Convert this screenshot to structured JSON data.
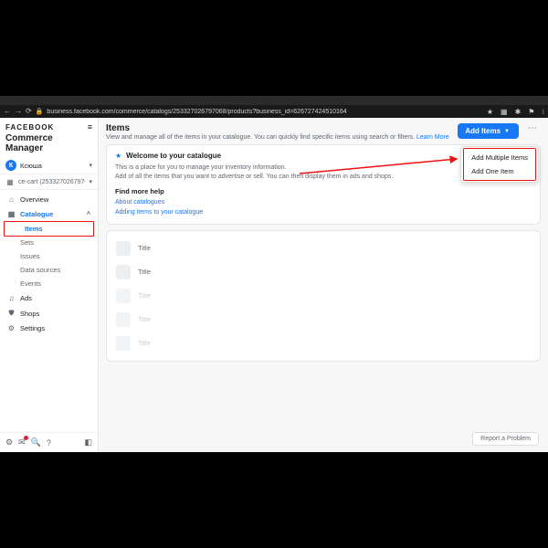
{
  "browser": {
    "url": "business.facebook.com/commerce/catalogs/253327026797068/products?business_id=626727424510164",
    "ext_icons": [
      "★",
      "▦",
      "✱",
      "⚑",
      "⁝"
    ]
  },
  "sidebar": {
    "brand": "FACEBOOK",
    "product": "Commerce Manager",
    "account": {
      "initial": "К",
      "name": "Ксюша"
    },
    "catalog_label": "ce-cart (253327026797068)",
    "nav": {
      "overview": "Overview",
      "catalogue": "Catalogue",
      "items": "Items",
      "sets": "Sets",
      "issues": "Issues",
      "data_sources": "Data sources",
      "events": "Events",
      "ads": "Ads",
      "shops": "Shops",
      "settings": "Settings"
    }
  },
  "page": {
    "title": "Items",
    "subtitle": "View and manage all of the items in your catalogue. You can quickly find specific items using search or filters.",
    "learn_more": "Learn More",
    "add_button": "Add Items",
    "dropdown": {
      "multiple": "Add Multiple Items",
      "one": "Add One Item"
    }
  },
  "welcome": {
    "title": "Welcome to your catalogue",
    "line1": "This is a place for you to manage your inventory information.",
    "line2": "Add of all the items that you want to advertise or sell. You can then display them in ads and shops.",
    "help_hd": "Find more help",
    "link1": "About catalogues",
    "link2": "Adding items to your catalogue"
  },
  "list": {
    "placeholder": "Title"
  },
  "footer": {
    "report": "Report a Problem"
  }
}
